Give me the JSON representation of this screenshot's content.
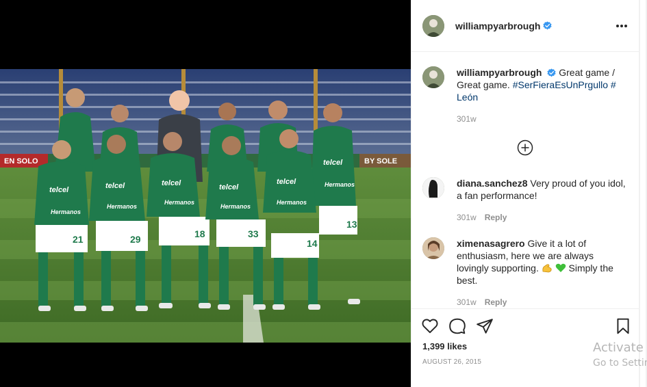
{
  "post": {
    "author": "williampyarbrough",
    "likes": "1,399 likes",
    "date": "August 26, 2015"
  },
  "photo": {
    "banner_left": "EN SOLO",
    "banner_right": "BY SOLE",
    "sponsor": "telcel",
    "sponsor_sub": "Hermanos",
    "numbers": [
      "21",
      "29",
      "18",
      "33",
      "14",
      "13"
    ]
  },
  "caption": {
    "username": "williampyarbrough",
    "text": "Great game / Great game.",
    "hashtag_1": "#SerFieraEsUnPrgullo",
    "hashtag_2": "# León",
    "time": "301w"
  },
  "comments": [
    {
      "username": "diana.sanchez8",
      "text": "Very proud of you idol, a fan performance!",
      "time": "301w",
      "reply": "Reply"
    },
    {
      "username": "ximenasagrero",
      "text": "Give it a lot of enthusiasm, here we are always lovingly supporting.",
      "text_after": "Simply the best.",
      "time": "301w",
      "reply": "Reply"
    }
  ],
  "icons": {
    "verified": "verified-badge-icon",
    "more": "more-options-icon",
    "load_more": "plus-circle-icon",
    "like": "heart-icon",
    "comment": "comment-icon",
    "share": "paper-plane-icon",
    "save": "bookmark-icon"
  },
  "colors": {
    "verified": "#3897f0",
    "hashtag": "#00376b",
    "meta": "#8e8e8e",
    "jersey": "#1f7a4c"
  },
  "watermark": {
    "line1": "Activate Windows",
    "line2": "Go to Settings to activate Windows."
  }
}
